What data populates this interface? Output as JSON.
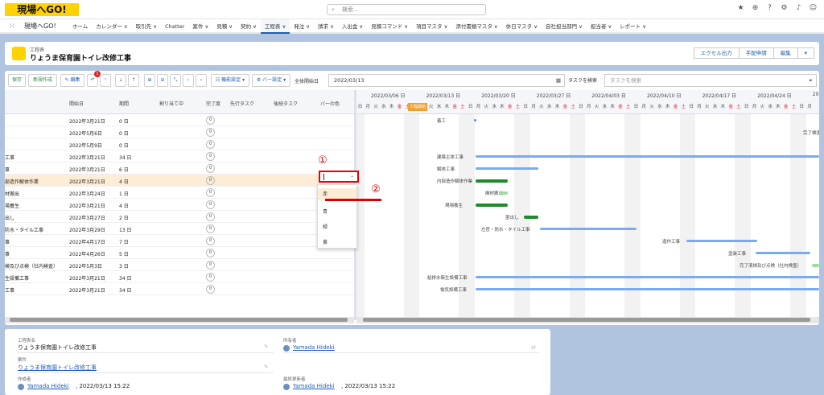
{
  "global": {
    "logo": "現場へGO!",
    "search_placeholder": "検索..."
  },
  "nav": {
    "app_name": "現場へGO!",
    "items": [
      {
        "label": "ホーム"
      },
      {
        "label": "カレンダー ∨"
      },
      {
        "label": "取引先 ∨"
      },
      {
        "label": "Chatter"
      },
      {
        "label": "案件 ∨"
      },
      {
        "label": "見積 ∨"
      },
      {
        "label": "契約 ∨"
      },
      {
        "label": "工程表 ∨",
        "active": true
      },
      {
        "label": "発注 ∨"
      },
      {
        "label": "請求 ∨"
      },
      {
        "label": "入出金 ∨"
      },
      {
        "label": "見積コマンド ∨"
      },
      {
        "label": "項目マスタ ∨"
      },
      {
        "label": "添付書類マスタ ∨"
      },
      {
        "label": "休日マスタ ∨"
      },
      {
        "label": "自社担当部門 ∨"
      },
      {
        "label": "担当者 ∨"
      },
      {
        "label": "レポート ∨"
      }
    ]
  },
  "header": {
    "object_label": "工程表",
    "title": "りょうま保育園トイレ改修工事",
    "buttons": [
      "エクセル出力",
      "手配申請",
      "編集"
    ]
  },
  "toolbar": {
    "save": "保存",
    "new": "新規作成",
    "edit": "✎ 編集",
    "undo_badge": "1",
    "display_settings": "☷ 機能設定 ▾",
    "bar_settings": "⚙ バー設定 ▾",
    "global_start_label": "全体開始日",
    "global_start_value": "2022/03/13",
    "task_search_label": "タスクを検索",
    "task_search_placeholder": "タスクを検索"
  },
  "grid": {
    "columns": [
      "開始日",
      "期間",
      "割り当て中",
      "完了度",
      "先行タスク",
      "後続タスク",
      "バーの色"
    ],
    "rows": [
      {
        "name": "",
        "start": "2022年3月21日",
        "duration": "0 日",
        "progress": "0"
      },
      {
        "name": "",
        "start": "2022年5月6日",
        "duration": "0 日",
        "progress": "0"
      },
      {
        "name": "",
        "start": "2022年5月9日",
        "duration": "0 日",
        "progress": "0"
      },
      {
        "name": "工事",
        "start": "2022年3月21日",
        "duration": "34 日",
        "progress": "0"
      },
      {
        "name": "事",
        "start": "2022年3月21日",
        "duration": "6 日",
        "progress": "0"
      },
      {
        "name": "部造作解体作業",
        "start": "2022年3月21日",
        "duration": "4 日",
        "progress": "0",
        "selected": true
      },
      {
        "name": "材搬出",
        "start": "2022年3月24日",
        "duration": "1 日",
        "progress": "0"
      },
      {
        "name": "場養生",
        "start": "2022年3月21日",
        "duration": "4 日",
        "progress": "0"
      },
      {
        "name": "出し",
        "start": "2022年3月27日",
        "duration": "2 日",
        "progress": "0"
      },
      {
        "name": "防水・タイル工事",
        "start": "2022年3月29日",
        "duration": "13 日",
        "progress": "0"
      },
      {
        "name": "事",
        "start": "2022年4月17日",
        "duration": "7 日",
        "progress": "0"
      },
      {
        "name": "事",
        "start": "2022年4月26日",
        "duration": "5 日",
        "progress": "0"
      },
      {
        "name": "検及び点検（社内検査）",
        "start": "2022年5月3日",
        "duration": "3 日",
        "progress": "0"
      },
      {
        "name": "生設備工事",
        "start": "2022年3月21日",
        "duration": "34 日",
        "progress": "0"
      },
      {
        "name": "工事",
        "start": "2022年3月21日",
        "duration": "34 日",
        "progress": "0"
      }
    ]
  },
  "gantt": {
    "weeks": [
      "2022/03/06 日",
      "2022/03/13 日",
      "2022/03/20 日",
      "2022/03/27 日",
      "2022/04/03 日",
      "2022/04/10 日",
      "2022/04/17 日",
      "2022/04/24 日",
      "2022/0"
    ],
    "days": [
      "日",
      "月",
      "火",
      "水",
      "木",
      "金",
      "土"
    ],
    "today_tag": "工程開始",
    "labels": [
      "着工",
      "完了検査",
      "建築主体工事",
      "解体工事",
      "内部造作解体作業",
      "廃材搬出",
      "現場養生",
      "墨出し",
      "左官・防水・タイル工事",
      "造作工事",
      "塗装工事",
      "完了清掃及び点検（社内検査）",
      "給排水衛生設備工事",
      "電気設備工事"
    ]
  },
  "dropdown": {
    "options": [
      "赤",
      "青",
      "緑",
      "黄"
    ],
    "marker1": "①",
    "marker2": "②"
  },
  "details": {
    "name_label": "工程表名",
    "name_value": "りょうま保育園トイレ改修工事",
    "project_label": "案件",
    "project_value": "りょうま保育園トイレ改修工事",
    "creator_label": "作成者",
    "creator_user": "Yamada Hideki",
    "creator_date": ", 2022/03/13 15:22",
    "owner_label": "所有者",
    "owner_user": "Yamada Hideki",
    "modifier_label": "最終更新者",
    "modifier_user": "Yamada Hideki",
    "modifier_date": ", 2022/03/13 15:22"
  },
  "colors": {
    "accent": "#1b5fb0",
    "brand": "#ffd200",
    "bar_green": "#1e8a2a",
    "bar_blue": "#7aaaf0",
    "highlight": "#fdecd6",
    "annotation": "#dd0000"
  }
}
